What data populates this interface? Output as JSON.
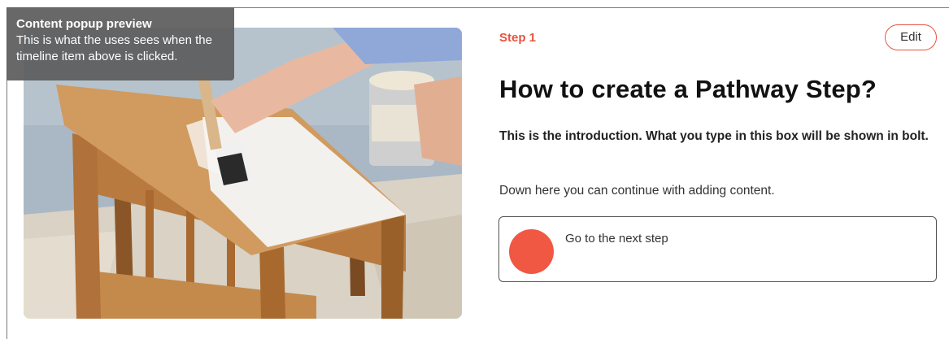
{
  "popup_tag": {
    "title": "Content popup preview",
    "description": "This is what the uses sees when the timeline item above is clicked."
  },
  "image": {
    "icon": "painting-table-photo"
  },
  "step": {
    "label": "Step 1",
    "edit_label": "Edit",
    "heading": "How to create a Pathway Step?",
    "introduction": "This is the introduction. What you type in this box will be shown in bolt.",
    "body": "Down here you can continue with adding content."
  },
  "next_step": {
    "label": "Go to the next step",
    "icon": "circle-icon",
    "color": "#f05844"
  },
  "colors": {
    "accent": "#e9523c",
    "popup_bg": "#5c5c5c"
  }
}
